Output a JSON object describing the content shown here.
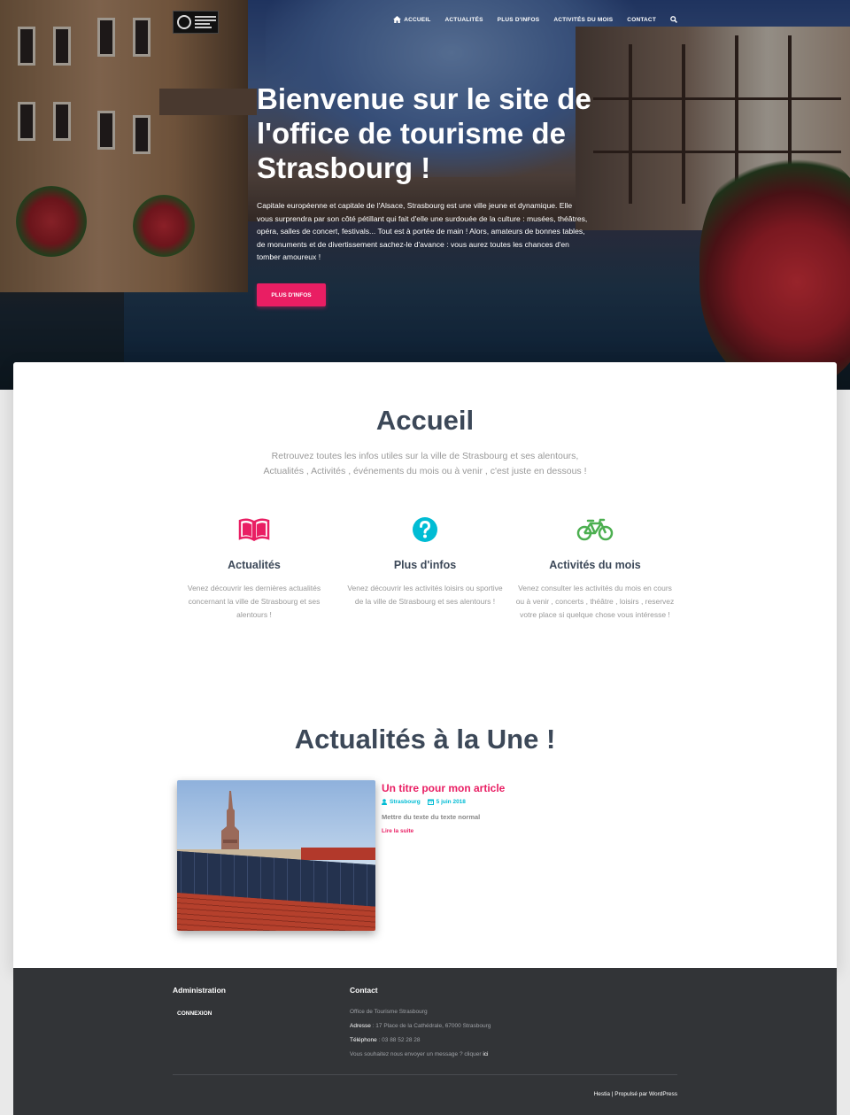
{
  "nav": {
    "items": [
      {
        "label": "ACCUEIL",
        "icon": "home-icon"
      },
      {
        "label": "ACTUALITÉS"
      },
      {
        "label": "PLUS D'INFOS"
      },
      {
        "label": "ACTIVITÉS DU MOIS"
      },
      {
        "label": "CONTACT"
      }
    ],
    "search_icon": "search-icon"
  },
  "hero": {
    "title": "Bienvenue sur le site de l'office de tourisme de Strasbourg !",
    "text": "Capitale européenne et capitale de l'Alsace, Strasbourg est une ville jeune et dynamique. Elle vous surprendra par son côté pétillant qui fait d'elle une surdouée de la culture : musées, théâtres, opéra, salles de concert, festivals... Tout est à portée de main ! Alors, amateurs de bonnes tables, de monuments et de divertissement sachez-le d'avance : vous aurez toutes les chances d'en tomber amoureux !",
    "button": "PLUS D'INFOS"
  },
  "accueil": {
    "title": "Accueil",
    "subtitle_line1": "Retrouvez toutes les infos utiles sur la ville de Strasbourg et ses alentours,",
    "subtitle_line2": "Actualités , Activités , événements du mois ou à venir , c'est juste en dessous !",
    "features": [
      {
        "icon": "book-icon",
        "color": "#e91e63",
        "title": "Actualités",
        "text": "Venez découvrir les dernières actualités concernant la ville de Strasbourg et ses alentours !"
      },
      {
        "icon": "question-icon",
        "color": "#00bcd4",
        "title": "Plus d'infos",
        "text": "Venez découvrir les activités loisirs ou sportive de la ville de Strasbourg et ses alentours !"
      },
      {
        "icon": "bicycle-icon",
        "color": "#4caf50",
        "title": "Activités du mois",
        "text": "Venez consulter les activités du mois en cours ou à venir , concerts , théâtre , loisirs , reservez votre place si quelque chose vous intéresse !"
      }
    ]
  },
  "news": {
    "title": "Actualités à la Une !",
    "article": {
      "title": "Un titre pour mon article",
      "author": "Strasbourg",
      "date": "5 juin 2018",
      "excerpt": "Mettre du texte du texte normal",
      "more": "Lire la suite"
    }
  },
  "footer": {
    "admin_title": "Administration",
    "login": "CONNEXION",
    "contact_title": "Contact",
    "org": "Office de Tourisme Strasbourg",
    "address_label": "Adresse",
    "address": " : 17 Place de la Cathédrale, 67000 Strasbourg",
    "phone_label": "Téléphone",
    "phone": " : 03 88 52 28 28",
    "message": "Vous souhaitez nous envoyer un message ? cliquer ",
    "message_link": "ici",
    "copyright_link": "Hestia",
    "copyright_rest": " | Propulsé par WordPress"
  },
  "colors": {
    "accent": "#e91e63",
    "info": "#00bcd4",
    "success": "#4caf50",
    "footer_bg": "#323437"
  }
}
